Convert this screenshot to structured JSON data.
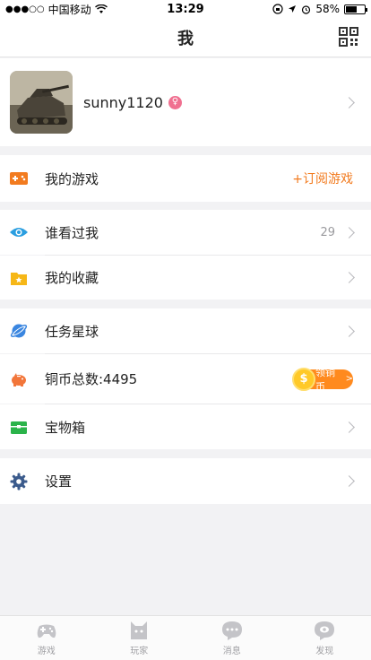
{
  "status_bar": {
    "signal_dots": "●●●○○",
    "carrier": "中国移动",
    "time": "13:29",
    "battery": "58%",
    "battery_level": 0.58
  },
  "nav": {
    "title": "我",
    "qr_icon": "qr-code-icon"
  },
  "profile": {
    "username": "sunny1120",
    "gender_symbol": "♀"
  },
  "menu": {
    "my_games": {
      "label": "我的游戏",
      "action": "+订阅游戏",
      "icon": "gamepad-icon",
      "color": "#f27b1f"
    },
    "visitors": {
      "label": "谁看过我",
      "count": "29",
      "icon": "eye-icon",
      "color": "#2a9ee0"
    },
    "favorites": {
      "label": "我的收藏",
      "icon": "folder-star-icon",
      "color": "#f6b717"
    },
    "quest_planet": {
      "label": "任务星球",
      "icon": "planet-icon",
      "color": "#3a86e0"
    },
    "coins": {
      "label": "铜币总数:4495",
      "badge": "领铜币",
      "coin_symbol": "$",
      "icon": "piggy-bank-icon",
      "color": "#f2763a"
    },
    "treasure": {
      "label": "宝物箱",
      "icon": "treasure-box-icon",
      "color": "#2bb34a"
    },
    "settings": {
      "label": "设置",
      "icon": "gear-icon",
      "color": "#3b5b8c"
    }
  },
  "tabs": [
    {
      "label": "游戏",
      "icon": "gamepad-tab-icon"
    },
    {
      "label": "玩家",
      "icon": "player-tab-icon"
    },
    {
      "label": "消息",
      "icon": "message-tab-icon"
    },
    {
      "label": "发现",
      "icon": "discover-tab-icon"
    }
  ]
}
